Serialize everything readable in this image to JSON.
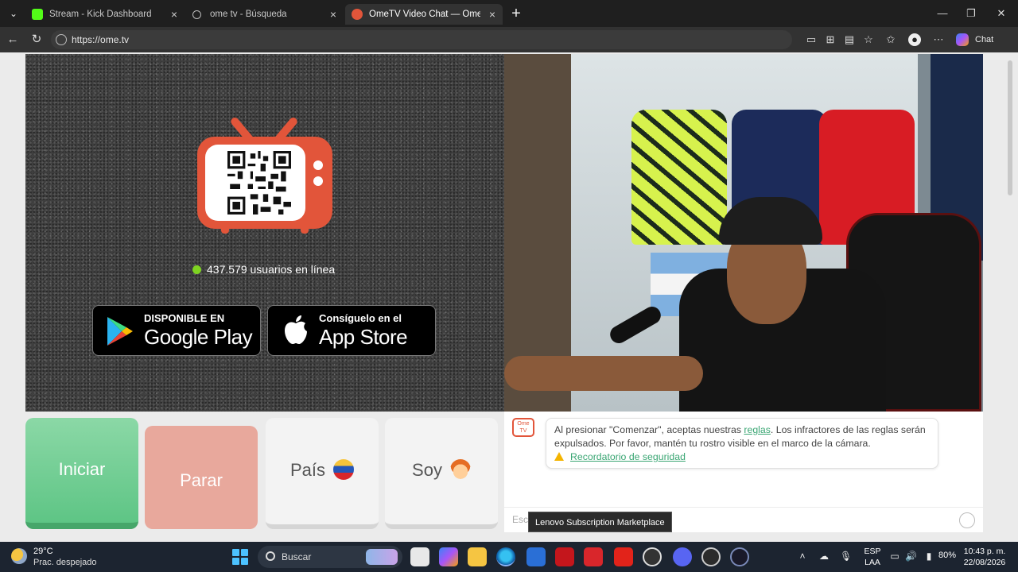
{
  "browser": {
    "tabs": [
      {
        "title": "Stream - Kick Dashboard",
        "icon": "kick-icon",
        "active": false
      },
      {
        "title": "ome tv - Búsqueda",
        "icon": "search-icon",
        "active": false
      },
      {
        "title": "OmeTV Video Chat — Omegl",
        "icon": "ometv-icon",
        "active": true
      }
    ],
    "url": "https://ome.tv",
    "copilot_label": "Chat"
  },
  "page": {
    "online_text": "437.579 usuarios en línea",
    "google_play": {
      "small": "DISPONIBLE EN",
      "big": "Google Play"
    },
    "app_store": {
      "small": "Consíguelo en el",
      "big": "App Store"
    },
    "buttons": {
      "start": "Iniciar",
      "stop": "Parar",
      "country": "País",
      "gender": "Soy"
    },
    "chat": {
      "logo_text": "Ome TV",
      "message_part1": "Al presionar \"Comenzar\", aceptas nuestras ",
      "rules_link": "reglas",
      "message_part2": ". Los infractores de las reglas serán expulsados. Por favor, mantén tu rostro visible en el marco de la cámara.",
      "security_link": "Recordatorio de seguridad",
      "input_placeholder": "Esc"
    },
    "tooltip": "Lenovo Subscription Marketplace"
  },
  "taskbar": {
    "weather_temp": "29°C",
    "weather_condition": "Prac. despejado",
    "search_label": "Buscar",
    "lang_line1": "ESP",
    "lang_line2": "LAA",
    "battery": "80%",
    "time": "10:43 p. m.",
    "date": "22/08/2026"
  },
  "colors": {
    "brand": "#e2553a",
    "start_green": "#5ec585",
    "stop_salmon": "#e8a89c",
    "online_dot": "#7ed321",
    "link_green": "#3aa673"
  }
}
